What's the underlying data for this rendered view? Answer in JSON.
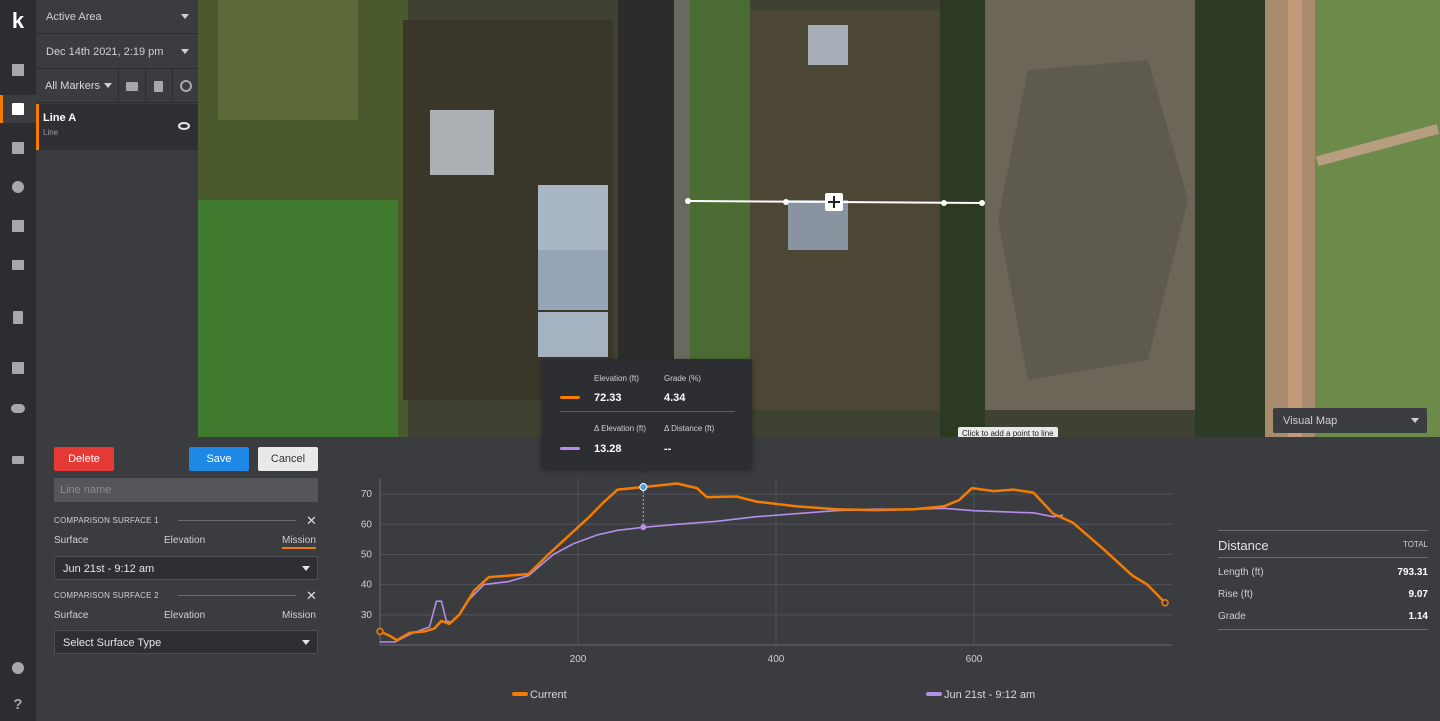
{
  "sidebar": {
    "logo": "k",
    "icons": [
      "dashboard-icon",
      "map-icon",
      "calendar-icon",
      "globe-icon",
      "image-icon",
      "upload-icon",
      "clipboard-icon",
      "chart-icon",
      "cloud-icon",
      "filter-list-icon",
      "settings-icon",
      "help-icon"
    ],
    "active": "map-icon",
    "help_label": "?"
  },
  "panel": {
    "area_select": "Active Area",
    "date_select": "Dec 14th 2021, 2:19 pm",
    "markers_filter": "All Markers",
    "items": [
      {
        "name": "Line A",
        "type": "Line"
      }
    ]
  },
  "map": {
    "layer_select": "Visual Map",
    "hint": "Click to add a point to line"
  },
  "form": {
    "delete_label": "Delete",
    "save_label": "Save",
    "cancel_label": "Cancel",
    "name_placeholder": "Line name",
    "surface1": {
      "title": "COMPARISON SURFACE 1",
      "tabs": [
        "Surface",
        "Elevation",
        "Mission"
      ],
      "active_tab": "Mission",
      "value": "Jun 21st - 9:12 am"
    },
    "surface2": {
      "title": "COMPARISON SURFACE 2",
      "tabs": [
        "Surface",
        "Elevation",
        "Mission"
      ],
      "value": "Select Surface Type"
    }
  },
  "tooltip": {
    "elevation_label": "Elevation (ft)",
    "elevation_value": "72.33",
    "grade_label": "Grade (%)",
    "grade_value": "4.34",
    "delta_elev_label": "Δ Elevation (ft)",
    "delta_elev_value": "13.28",
    "delta_dist_label": "Δ Distance (ft)",
    "delta_dist_value": "--"
  },
  "stats": {
    "heading": "Distance",
    "column": "TOTAL",
    "rows": [
      {
        "label": "Length (ft)",
        "value": "793.31"
      },
      {
        "label": "Rise (ft)",
        "value": "9.07"
      },
      {
        "label": "Grade",
        "value": "1.14"
      }
    ]
  },
  "colors": {
    "accent": "#f57c00",
    "current_series": "#f57c00",
    "comparison_series": "#b48ee8",
    "delete": "#e53935",
    "save": "#1e88e5"
  },
  "chart_data": {
    "type": "line",
    "xlim": [
      0,
      800
    ],
    "ylim": [
      20,
      75
    ],
    "x_ticks": [
      200,
      400,
      600
    ],
    "y_ticks": [
      30,
      40,
      50,
      60,
      70
    ],
    "grid": true,
    "legend_position": "bottom",
    "series": [
      {
        "name": "Current",
        "color": "#f57c00",
        "points": [
          [
            0,
            24.5
          ],
          [
            10,
            23
          ],
          [
            17,
            21.6
          ],
          [
            30,
            24
          ],
          [
            45,
            24.5
          ],
          [
            55,
            25.5
          ],
          [
            62,
            28
          ],
          [
            70,
            27
          ],
          [
            80,
            30
          ],
          [
            95,
            38
          ],
          [
            110,
            42.5
          ],
          [
            150,
            43.5
          ],
          [
            170,
            50
          ],
          [
            190,
            56
          ],
          [
            210,
            62
          ],
          [
            225,
            67
          ],
          [
            240,
            71.5
          ],
          [
            266,
            72.3
          ],
          [
            300,
            73.5
          ],
          [
            320,
            72
          ],
          [
            330,
            69
          ],
          [
            360,
            69.2
          ],
          [
            380,
            67.5
          ],
          [
            420,
            66
          ],
          [
            460,
            65
          ],
          [
            500,
            64.7
          ],
          [
            540,
            65
          ],
          [
            570,
            66
          ],
          [
            585,
            68
          ],
          [
            598,
            72
          ],
          [
            620,
            71
          ],
          [
            640,
            71.5
          ],
          [
            660,
            70.5
          ],
          [
            680,
            63.5
          ],
          [
            700,
            60.5
          ],
          [
            730,
            52
          ],
          [
            760,
            43
          ],
          [
            775,
            40
          ],
          [
            793,
            34
          ]
        ]
      },
      {
        "name": "Jun 21st - 9:12 am",
        "color": "#b48ee8",
        "points": [
          [
            0,
            21
          ],
          [
            15,
            21
          ],
          [
            30,
            23.5
          ],
          [
            50,
            26
          ],
          [
            57,
            34.5
          ],
          [
            62,
            34.5
          ],
          [
            67,
            28
          ],
          [
            72,
            27.5
          ],
          [
            80,
            30
          ],
          [
            90,
            35
          ],
          [
            105,
            40
          ],
          [
            130,
            41
          ],
          [
            150,
            43
          ],
          [
            175,
            50
          ],
          [
            195,
            53.5
          ],
          [
            220,
            56.5
          ],
          [
            240,
            58
          ],
          [
            266,
            59
          ],
          [
            300,
            60
          ],
          [
            340,
            61
          ],
          [
            380,
            62.5
          ],
          [
            420,
            63.5
          ],
          [
            460,
            64.5
          ],
          [
            500,
            65
          ],
          [
            540,
            65
          ],
          [
            570,
            65.3
          ],
          [
            600,
            64.5
          ],
          [
            640,
            64
          ],
          [
            660,
            63.8
          ],
          [
            680,
            62.5
          ],
          [
            690,
            63
          ]
        ]
      }
    ]
  }
}
